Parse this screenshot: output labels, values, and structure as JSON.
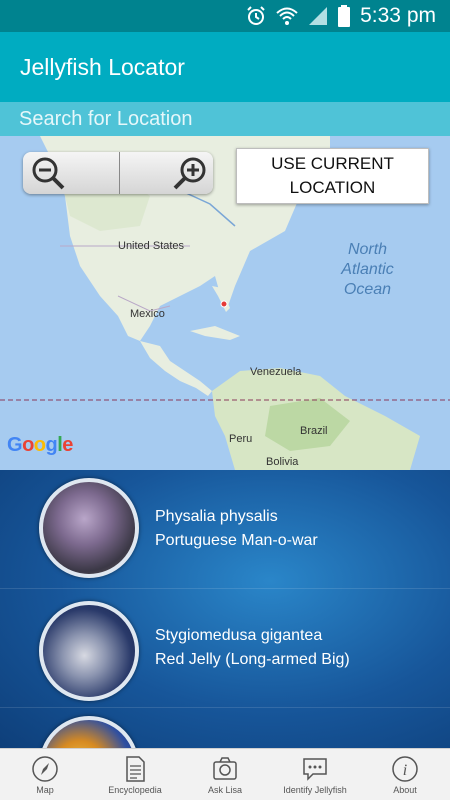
{
  "status_bar": {
    "time": "5:33 pm"
  },
  "app_bar": {
    "title": "Jellyfish Locator"
  },
  "search": {
    "placeholder": "Search for Location"
  },
  "map": {
    "location_button": "USE CURRENT LOCATION",
    "labels": {
      "united_states": "United States",
      "mexico": "Mexico",
      "venezuela": "Venezuela",
      "brazil": "Brazil",
      "peru": "Peru",
      "bolivia": "Bolivia",
      "ocean": "North Atlantic Ocean"
    },
    "google_logo": "Google",
    "zoom_out_icon": "zoom-out-icon",
    "zoom_in_icon": "zoom-in-icon"
  },
  "species": [
    {
      "scientific": "Physalia  physalis",
      "common": "Portuguese Man-o-war"
    },
    {
      "scientific": "Stygiomedusa gigantea",
      "common": "Red Jelly (Long-armed Big)"
    },
    {
      "scientific": "",
      "common": ""
    }
  ],
  "bottom_nav": [
    {
      "label": "Map",
      "icon": "compass-icon"
    },
    {
      "label": "Encyclopedia",
      "icon": "document-icon"
    },
    {
      "label": "Ask Lisa",
      "icon": "camera-icon"
    },
    {
      "label": "Identify Jellyfish",
      "icon": "speech-bubble-icon"
    },
    {
      "label": "About",
      "icon": "info-icon"
    }
  ],
  "colors": {
    "status_bar": "#00838f",
    "app_bar": "#00acc1",
    "search_bar": "#4fc3d7",
    "list_bg": "#17569a"
  }
}
